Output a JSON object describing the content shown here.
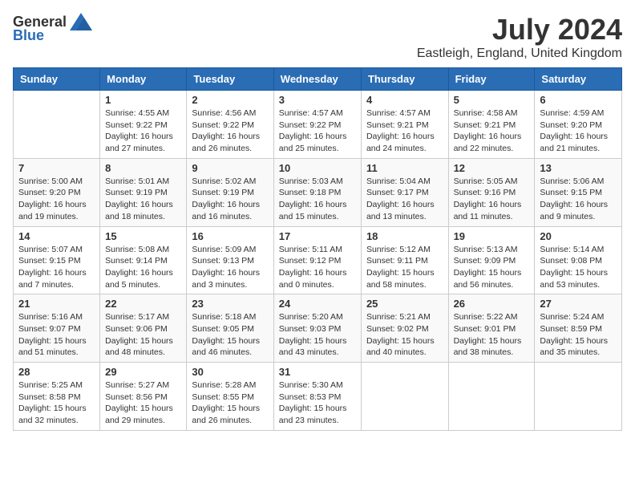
{
  "logo": {
    "general": "General",
    "blue": "Blue"
  },
  "title": "July 2024",
  "location": "Eastleigh, England, United Kingdom",
  "days_of_week": [
    "Sunday",
    "Monday",
    "Tuesday",
    "Wednesday",
    "Thursday",
    "Friday",
    "Saturday"
  ],
  "weeks": [
    [
      {
        "day": "",
        "info": ""
      },
      {
        "day": "1",
        "info": "Sunrise: 4:55 AM\nSunset: 9:22 PM\nDaylight: 16 hours\nand 27 minutes."
      },
      {
        "day": "2",
        "info": "Sunrise: 4:56 AM\nSunset: 9:22 PM\nDaylight: 16 hours\nand 26 minutes."
      },
      {
        "day": "3",
        "info": "Sunrise: 4:57 AM\nSunset: 9:22 PM\nDaylight: 16 hours\nand 25 minutes."
      },
      {
        "day": "4",
        "info": "Sunrise: 4:57 AM\nSunset: 9:21 PM\nDaylight: 16 hours\nand 24 minutes."
      },
      {
        "day": "5",
        "info": "Sunrise: 4:58 AM\nSunset: 9:21 PM\nDaylight: 16 hours\nand 22 minutes."
      },
      {
        "day": "6",
        "info": "Sunrise: 4:59 AM\nSunset: 9:20 PM\nDaylight: 16 hours\nand 21 minutes."
      }
    ],
    [
      {
        "day": "7",
        "info": "Sunrise: 5:00 AM\nSunset: 9:20 PM\nDaylight: 16 hours\nand 19 minutes."
      },
      {
        "day": "8",
        "info": "Sunrise: 5:01 AM\nSunset: 9:19 PM\nDaylight: 16 hours\nand 18 minutes."
      },
      {
        "day": "9",
        "info": "Sunrise: 5:02 AM\nSunset: 9:19 PM\nDaylight: 16 hours\nand 16 minutes."
      },
      {
        "day": "10",
        "info": "Sunrise: 5:03 AM\nSunset: 9:18 PM\nDaylight: 16 hours\nand 15 minutes."
      },
      {
        "day": "11",
        "info": "Sunrise: 5:04 AM\nSunset: 9:17 PM\nDaylight: 16 hours\nand 13 minutes."
      },
      {
        "day": "12",
        "info": "Sunrise: 5:05 AM\nSunset: 9:16 PM\nDaylight: 16 hours\nand 11 minutes."
      },
      {
        "day": "13",
        "info": "Sunrise: 5:06 AM\nSunset: 9:15 PM\nDaylight: 16 hours\nand 9 minutes."
      }
    ],
    [
      {
        "day": "14",
        "info": "Sunrise: 5:07 AM\nSunset: 9:15 PM\nDaylight: 16 hours\nand 7 minutes."
      },
      {
        "day": "15",
        "info": "Sunrise: 5:08 AM\nSunset: 9:14 PM\nDaylight: 16 hours\nand 5 minutes."
      },
      {
        "day": "16",
        "info": "Sunrise: 5:09 AM\nSunset: 9:13 PM\nDaylight: 16 hours\nand 3 minutes."
      },
      {
        "day": "17",
        "info": "Sunrise: 5:11 AM\nSunset: 9:12 PM\nDaylight: 16 hours\nand 0 minutes."
      },
      {
        "day": "18",
        "info": "Sunrise: 5:12 AM\nSunset: 9:11 PM\nDaylight: 15 hours\nand 58 minutes."
      },
      {
        "day": "19",
        "info": "Sunrise: 5:13 AM\nSunset: 9:09 PM\nDaylight: 15 hours\nand 56 minutes."
      },
      {
        "day": "20",
        "info": "Sunrise: 5:14 AM\nSunset: 9:08 PM\nDaylight: 15 hours\nand 53 minutes."
      }
    ],
    [
      {
        "day": "21",
        "info": "Sunrise: 5:16 AM\nSunset: 9:07 PM\nDaylight: 15 hours\nand 51 minutes."
      },
      {
        "day": "22",
        "info": "Sunrise: 5:17 AM\nSunset: 9:06 PM\nDaylight: 15 hours\nand 48 minutes."
      },
      {
        "day": "23",
        "info": "Sunrise: 5:18 AM\nSunset: 9:05 PM\nDaylight: 15 hours\nand 46 minutes."
      },
      {
        "day": "24",
        "info": "Sunrise: 5:20 AM\nSunset: 9:03 PM\nDaylight: 15 hours\nand 43 minutes."
      },
      {
        "day": "25",
        "info": "Sunrise: 5:21 AM\nSunset: 9:02 PM\nDaylight: 15 hours\nand 40 minutes."
      },
      {
        "day": "26",
        "info": "Sunrise: 5:22 AM\nSunset: 9:01 PM\nDaylight: 15 hours\nand 38 minutes."
      },
      {
        "day": "27",
        "info": "Sunrise: 5:24 AM\nSunset: 8:59 PM\nDaylight: 15 hours\nand 35 minutes."
      }
    ],
    [
      {
        "day": "28",
        "info": "Sunrise: 5:25 AM\nSunset: 8:58 PM\nDaylight: 15 hours\nand 32 minutes."
      },
      {
        "day": "29",
        "info": "Sunrise: 5:27 AM\nSunset: 8:56 PM\nDaylight: 15 hours\nand 29 minutes."
      },
      {
        "day": "30",
        "info": "Sunrise: 5:28 AM\nSunset: 8:55 PM\nDaylight: 15 hours\nand 26 minutes."
      },
      {
        "day": "31",
        "info": "Sunrise: 5:30 AM\nSunset: 8:53 PM\nDaylight: 15 hours\nand 23 minutes."
      },
      {
        "day": "",
        "info": ""
      },
      {
        "day": "",
        "info": ""
      },
      {
        "day": "",
        "info": ""
      }
    ]
  ]
}
